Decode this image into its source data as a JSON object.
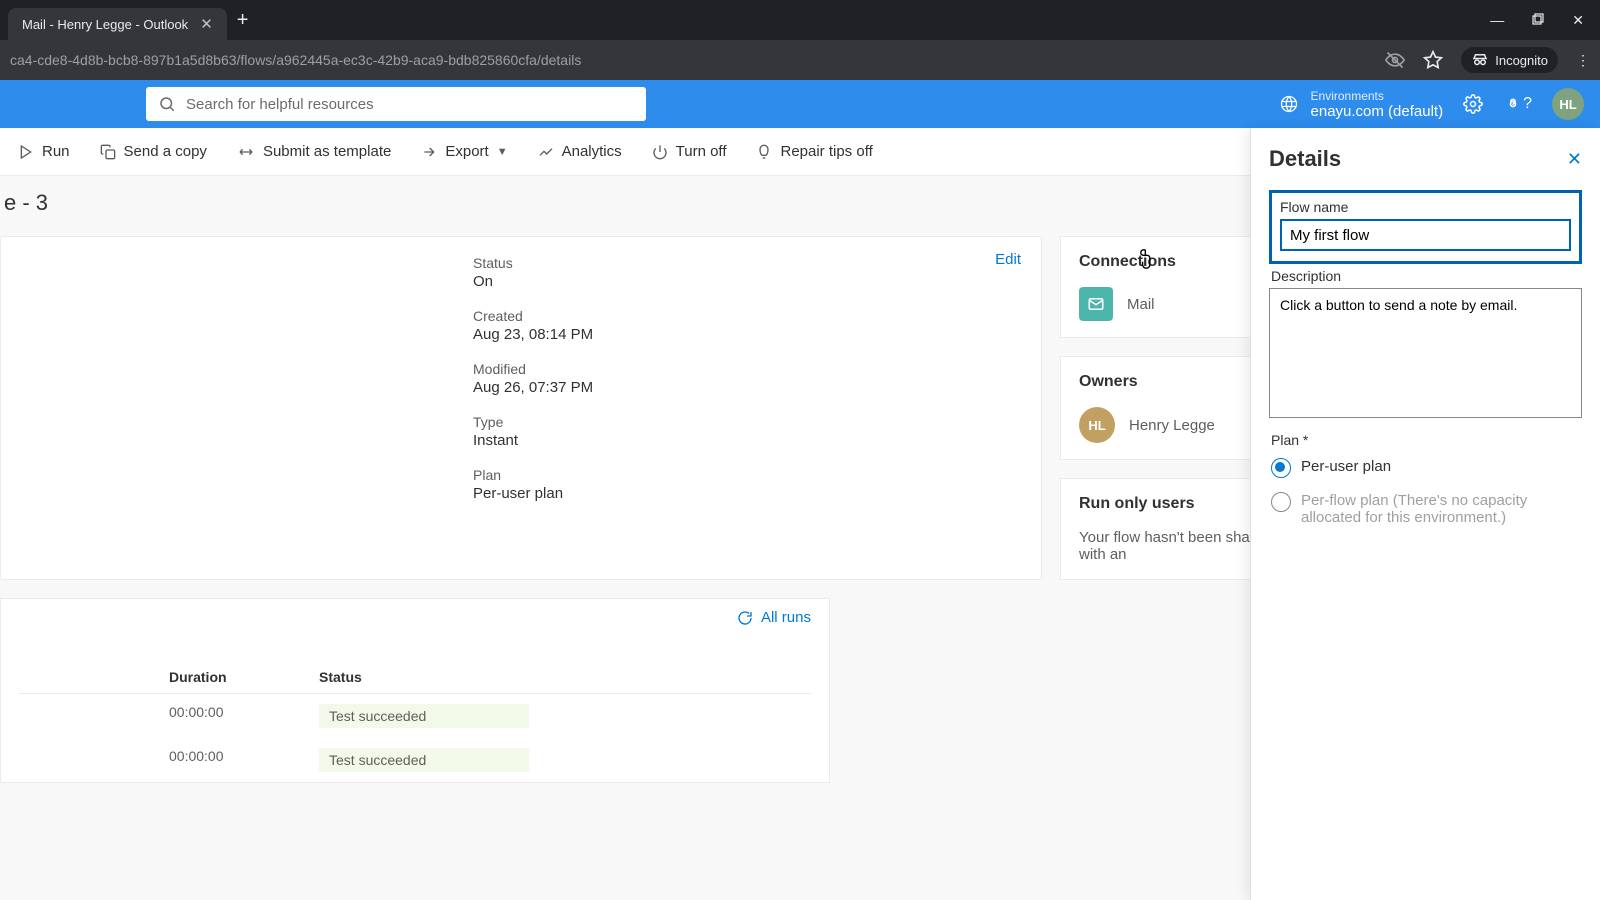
{
  "browser": {
    "tab_title": "Mail - Henry Legge - Outlook",
    "new_tab": "+",
    "address": "ca4-cde8-4d8b-bcb8-897b1a5d8b63/flows/a962445a-ec3c-42b9-aca9-bdb825860cfa/details",
    "incognito": "Incognito"
  },
  "header": {
    "search_placeholder": "Search for helpful resources",
    "env_label": "Environments",
    "env_value": "enayu.com (default)",
    "avatar": "HL"
  },
  "toolbar": {
    "run": "Run",
    "send_copy": "Send a copy",
    "submit_template": "Submit as template",
    "export": "Export",
    "analytics": "Analytics",
    "turn_off": "Turn off",
    "repair_tips_off": "Repair tips off"
  },
  "page": {
    "title": "e - 3"
  },
  "details_card": {
    "edit": "Edit",
    "status_lbl": "Status",
    "status_val": "On",
    "created_lbl": "Created",
    "created_val": "Aug 23, 08:14 PM",
    "modified_lbl": "Modified",
    "modified_val": "Aug 26, 07:37 PM",
    "type_lbl": "Type",
    "type_val": "Instant",
    "plan_lbl": "Plan",
    "plan_val": "Per-user plan"
  },
  "connections": {
    "title": "Connections",
    "items": [
      {
        "label": "Mail"
      }
    ]
  },
  "owners": {
    "title": "Owners",
    "items": [
      {
        "initials": "HL",
        "name": "Henry Legge"
      }
    ]
  },
  "run_only": {
    "title": "Run only users",
    "text": "Your flow hasn't been shared with an"
  },
  "runs": {
    "all_runs": "All runs",
    "col_duration": "Duration",
    "col_status": "Status",
    "rows": [
      {
        "duration": "00:00:00",
        "status": "Test succeeded"
      },
      {
        "duration": "00:00:00",
        "status": "Test succeeded"
      }
    ]
  },
  "panel": {
    "title": "Details",
    "flow_name_lbl": "Flow name",
    "flow_name_val": "My first flow",
    "description_lbl": "Description",
    "description_val": "Click a button to send a note by email.",
    "plan_lbl": "Plan *",
    "plan_options": {
      "per_user": "Per-user plan",
      "per_flow": "Per-flow plan (There's no capacity allocated for this environment.)"
    }
  }
}
